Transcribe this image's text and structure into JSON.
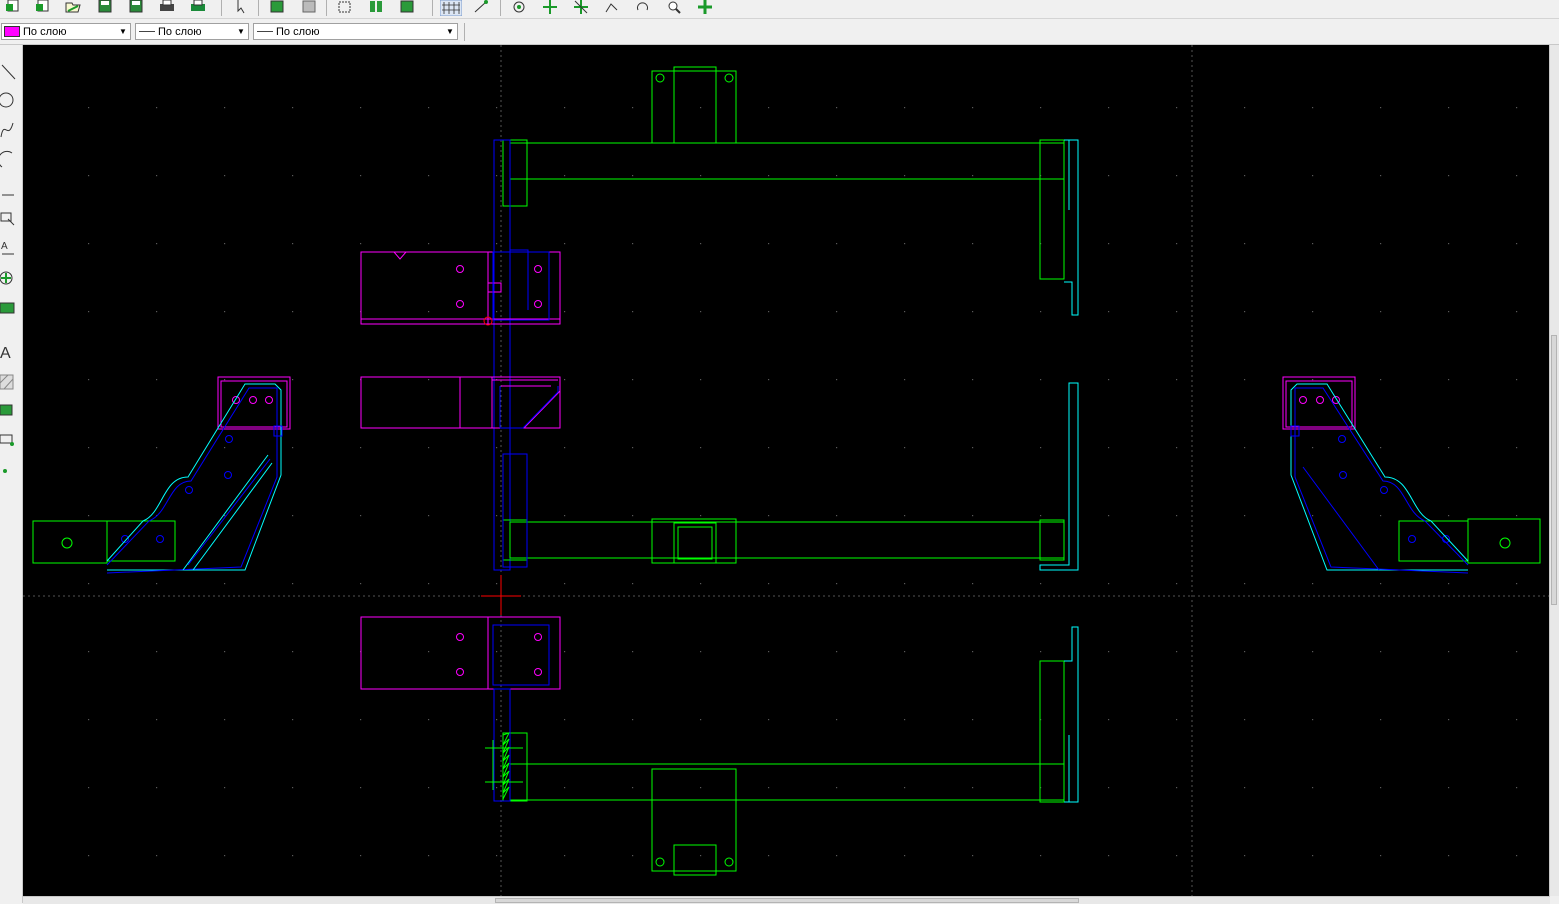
{
  "toolbar": {
    "buttons": [
      "new-icon",
      "new-from-template-icon",
      "open-icon",
      "save-icon",
      "save-as-icon",
      "print-icon",
      "print-preview-icon",
      "select-icon",
      "copy-icon",
      "paste-icon",
      "block-icon",
      "insert-block-icon",
      "insert-image-icon",
      "grid-icon",
      "snap-icon",
      "rotate-icon",
      "zoom-window-icon",
      "zoom-extents-icon",
      "zoom-previous-icon",
      "redraw-icon",
      "zoom-icon",
      "pan-icon"
    ]
  },
  "properties": {
    "color": {
      "value": "По слою",
      "swatch": "#ff00ff"
    },
    "linetype": {
      "value": "По слою"
    },
    "lineweight": {
      "value": "По слою"
    }
  },
  "tools": [
    "line-tool-icon",
    "circle-tool-icon",
    "spline-tool-icon",
    "arc-tool-icon",
    "polyline-tool-icon",
    "select-tool-icon",
    "text-tool-icon",
    "snap-tool-icon",
    "dimension-tool-icon",
    "mtext-tool-icon",
    "hatch-tool-icon",
    "image-tool-icon",
    "block-tool-icon",
    "point-tool-icon"
  ],
  "drawing": {
    "background": "#000000",
    "colors": {
      "frame": "#00ff00",
      "profile": "#00ffff",
      "plate": "#ff00ff",
      "bracket": "#0000ff",
      "cursor": "#ff0000",
      "grid": "#5a5a5a"
    }
  }
}
